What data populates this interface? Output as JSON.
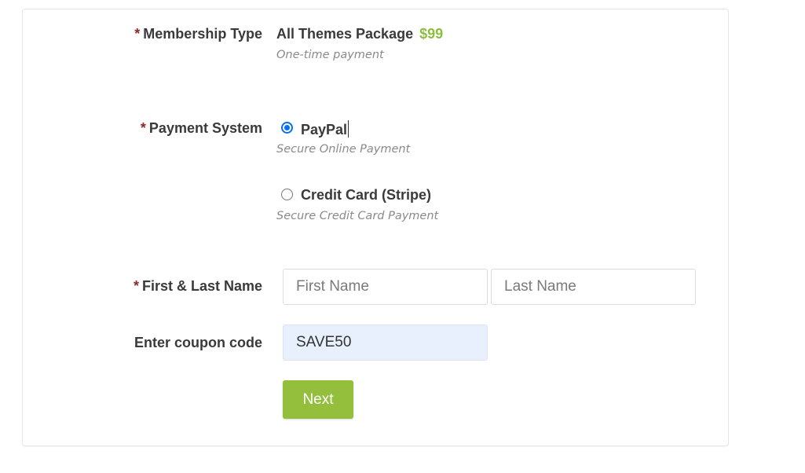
{
  "membership": {
    "label": "Membership Type",
    "required_mark": "*",
    "package_name": "All Themes Package",
    "price": "$99",
    "description": "One-time payment",
    "price_color": "#8cbf3f"
  },
  "payment": {
    "label": "Payment System",
    "required_mark": "*",
    "options": [
      {
        "label": "PayPal",
        "description": "Secure Online Payment",
        "selected": true
      },
      {
        "label": "Credit Card (Stripe)",
        "description": "Secure Credit Card Payment",
        "selected": false
      }
    ]
  },
  "name": {
    "label": "First & Last Name",
    "required_mark": "*",
    "first_placeholder": "First Name",
    "first_value": "",
    "last_placeholder": "Last Name",
    "last_value": ""
  },
  "coupon": {
    "label": "Enter coupon code",
    "value": "SAVE50"
  },
  "actions": {
    "next_label": "Next",
    "accent_color": "#93bf3c"
  }
}
